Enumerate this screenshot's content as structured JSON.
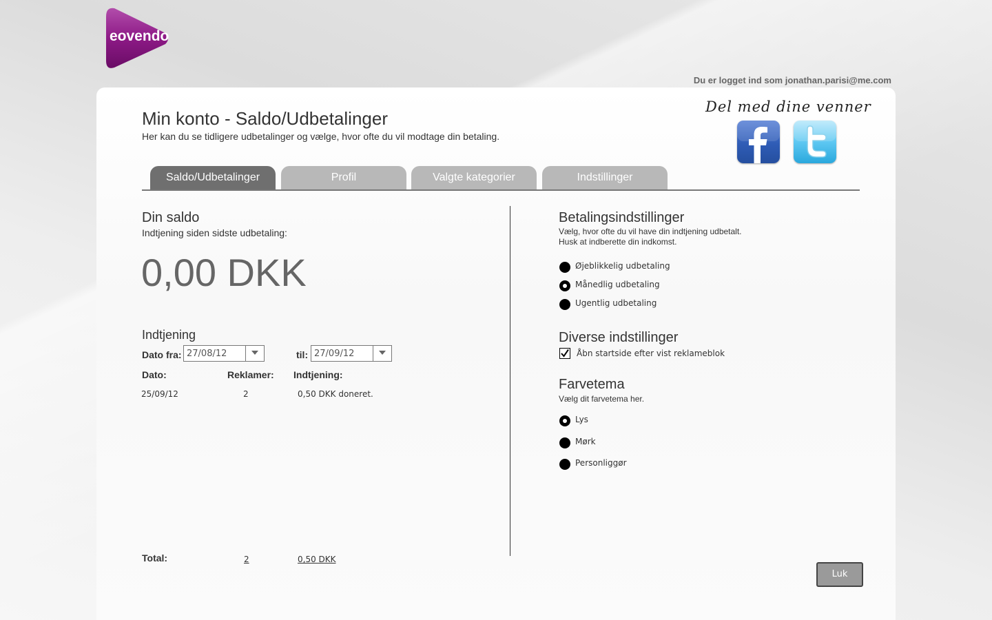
{
  "header": {
    "logo_text": "eovendo",
    "logged_in": "Du er logget ind som jonathan.parisi@me.com"
  },
  "page": {
    "title": "Min konto - Saldo/Udbetalinger",
    "subtitle": "Her kan du se tidligere udbetalinger og vælge, hvor ofte du vil modtage din betaling."
  },
  "share": {
    "label": "Del med dine venner",
    "icons": [
      "facebook-icon",
      "twitter-icon"
    ]
  },
  "tabs": [
    {
      "label": "Saldo/Udbetalinger",
      "active": true
    },
    {
      "label": "Profil",
      "active": false
    },
    {
      "label": "Valgte kategorier",
      "active": false
    },
    {
      "label": "Indstillinger",
      "active": false
    }
  ],
  "saldo": {
    "heading": "Din saldo",
    "caption": "Indtjening siden sidste udbetaling:",
    "amount": "0,00 DKK"
  },
  "earnings": {
    "heading": "Indtjening",
    "from_label": "Dato fra:",
    "from_value": "27/08/12",
    "to_label": "til:",
    "to_value": "27/09/12",
    "columns": [
      "Dato:",
      "Reklamer:",
      "Indtjening:"
    ],
    "rows": [
      {
        "date": "25/09/12",
        "ads": "2",
        "earning": "0,50 DKK doneret."
      }
    ],
    "total_label": "Total:",
    "total_ads": "2",
    "total_amount": "0,50 DKK"
  },
  "payment": {
    "heading": "Betalingsindstillinger",
    "desc1": "Vælg, hvor ofte du vil have din indtjening udbetalt.",
    "desc2": "Husk at indberette din indkomst.",
    "options": [
      {
        "label": "Øjeblikkelig udbetaling",
        "selected": false
      },
      {
        "label": "Månedlig udbetaling",
        "selected": true
      },
      {
        "label": "Ugentlig udbetaling",
        "selected": false
      }
    ]
  },
  "misc": {
    "heading": "Diverse indstillinger",
    "checkbox_label": "Åbn startside efter vist reklameblok",
    "checked": true
  },
  "theme": {
    "heading": "Farvetema",
    "desc": "Vælg dit farvetema her.",
    "options": [
      {
        "label": "Lys",
        "selected": true
      },
      {
        "label": "Mørk",
        "selected": false
      },
      {
        "label": "Personliggør",
        "selected": false
      }
    ]
  },
  "close_button": "Luk"
}
